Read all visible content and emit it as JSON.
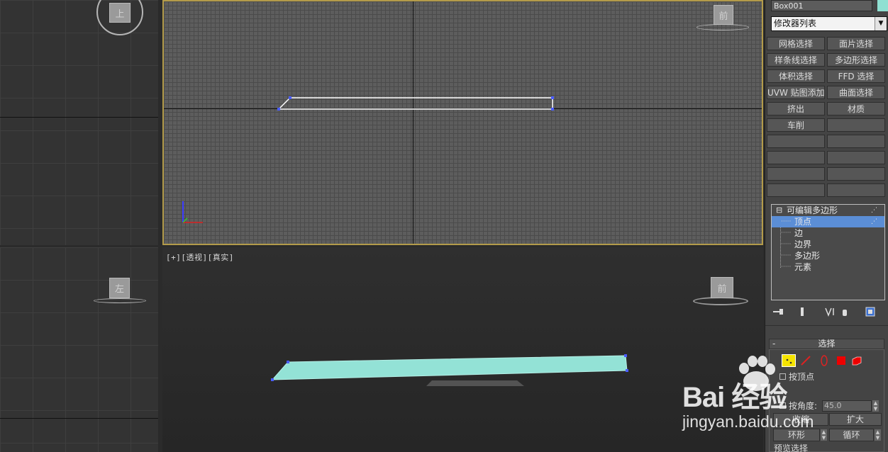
{
  "viewports": {
    "top_left": {
      "cube_label": "上"
    },
    "main_top": {
      "cube_label": "前"
    },
    "bottom_left": {
      "cube_label": "左"
    },
    "perspective": {
      "label_parts": [
        "[+]",
        "[透视]",
        "[真实]"
      ],
      "cube_label": "前"
    }
  },
  "command_panel": {
    "object_name": "Box001",
    "object_color": "#8fe0d2",
    "modifier_list": "修改器列表",
    "modifier_buttons": [
      "网格选择",
      "面片选择",
      "样条线选择",
      "多边形选择",
      "体积选择",
      "FFD 选择",
      "UVW 贴图添加",
      "曲面选择",
      "挤出",
      "材质",
      "车削",
      "",
      "",
      "",
      "",
      "",
      "",
      "",
      "",
      ""
    ],
    "stack": {
      "root": "可编辑多边形",
      "root_toggle": "⊟",
      "items": [
        "顶点",
        "边",
        "边界",
        "多边形",
        "元素"
      ],
      "selected": "顶点"
    },
    "stack_tools": [
      "pin-stack-icon",
      "show-end-result-icon",
      "make-unique-icon",
      "remove-modifier-icon",
      "configure-sets-icon"
    ],
    "selection_rollout": {
      "title": "选择",
      "collapse": "-",
      "subobject_icons": [
        "vertex-icon",
        "edge-icon",
        "border-icon",
        "polygon-icon",
        "element-icon"
      ],
      "by_vertex": "按顶点",
      "by_angle": "按角度:",
      "angle_value": "45.0",
      "shrink": "收缩",
      "grow": "扩大",
      "ring": "环形",
      "loop": "循环",
      "preview": "预览选择"
    }
  },
  "watermark": {
    "logo": "Bai 经验",
    "url": "jingyan.baidu.com"
  },
  "colors": {
    "viewport_active_border": "#b39b4a",
    "selected_item": "#5b8ed6",
    "object_fill": "#93e2d6"
  }
}
